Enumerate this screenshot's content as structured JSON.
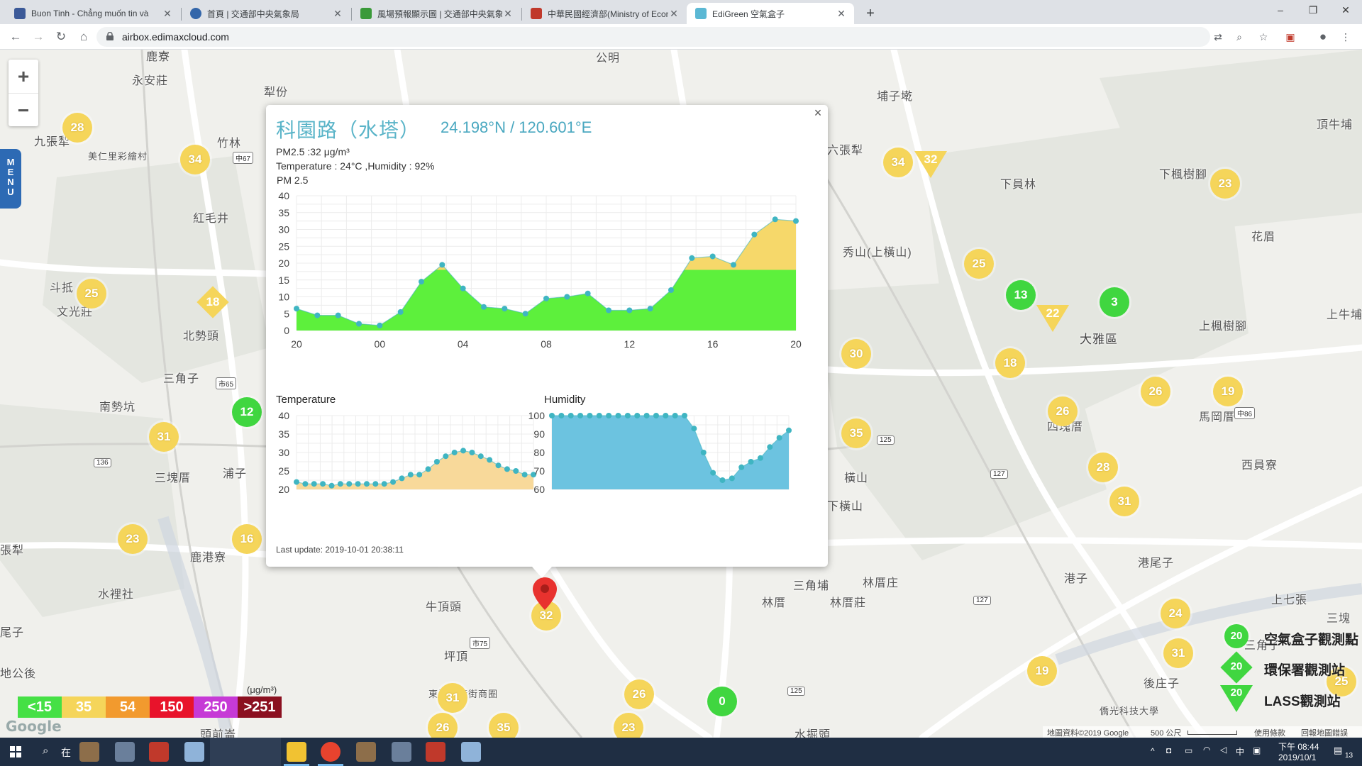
{
  "browser": {
    "tabs": [
      {
        "title": "Buon Tinh - Chẳng muốn tin và",
        "color": "#3b5998"
      },
      {
        "title": "首頁 | 交通部中央氣象局",
        "color": "#3366aa"
      },
      {
        "title": "風場預報顯示圖 | 交通部中央氣象",
        "color": "#3a9a3a"
      },
      {
        "title": "中華民國經濟部(Ministry of Econ",
        "color": "#c0392b"
      },
      {
        "title": "EdiGreen 空氣盒子",
        "color": "#5bb8d4"
      }
    ],
    "new_tab": "+",
    "url": "airbox.edimaxcloud.com",
    "window_controls": {
      "minimize": "–",
      "restore": "❐",
      "close": "✕"
    }
  },
  "map": {
    "zoom_in": "+",
    "zoom_out": "−",
    "menu_label": "MENU",
    "places": [
      {
        "text": "鹿寮"
      },
      {
        "text": "公明"
      },
      {
        "text": "永安莊"
      },
      {
        "text": "犁份"
      },
      {
        "text": "埔子墘"
      },
      {
        "text": "九張犁"
      },
      {
        "text": "竹林"
      },
      {
        "text": "美仁里彩繪村"
      },
      {
        "text": "六張犁"
      },
      {
        "text": "頂牛埔"
      },
      {
        "text": "下員林"
      },
      {
        "text": "下楓樹腳"
      },
      {
        "text": "紅毛井"
      },
      {
        "text": "花眉"
      },
      {
        "text": "秀山(上橫山)"
      },
      {
        "text": "斗抵"
      },
      {
        "text": "文光莊"
      },
      {
        "text": "北勢頭"
      },
      {
        "text": "上楓樹腳"
      },
      {
        "text": "大雅區"
      },
      {
        "text": "上牛埔"
      },
      {
        "text": "三角子"
      },
      {
        "text": "南勢坑"
      },
      {
        "text": "四塊厝"
      },
      {
        "text": "馬岡厝"
      },
      {
        "text": "三塊厝"
      },
      {
        "text": "浦子"
      },
      {
        "text": "橫山"
      },
      {
        "text": "下橫山"
      },
      {
        "text": "西員寮"
      },
      {
        "text": "鹿港寮"
      },
      {
        "text": "港子"
      },
      {
        "text": "港尾子"
      },
      {
        "text": "林厝庄"
      },
      {
        "text": "林厝"
      },
      {
        "text": "林厝莊"
      },
      {
        "text": "三角埔"
      },
      {
        "text": "牛頂頭"
      },
      {
        "text": "水裡社"
      },
      {
        "text": "上七張"
      },
      {
        "text": "坪頂"
      },
      {
        "text": "東海藝術街商圈"
      },
      {
        "text": "頭前崙"
      },
      {
        "text": "後庄子"
      },
      {
        "text": "水掘頭"
      },
      {
        "text": "地公後"
      },
      {
        "text": "張犁"
      },
      {
        "text": "僑光科技大學"
      },
      {
        "text": "尾子"
      },
      {
        "text": "三塊"
      },
      {
        "text": "三角子"
      }
    ],
    "roads": [
      {
        "text": "中67"
      },
      {
        "text": "市65"
      },
      {
        "text": "136"
      },
      {
        "text": "125"
      },
      {
        "text": "127"
      },
      {
        "text": "市75"
      },
      {
        "text": "125"
      },
      {
        "text": "127"
      },
      {
        "text": "中86"
      }
    ],
    "markers": [
      {
        "value": "28",
        "kind": "circle",
        "color": "yellow"
      },
      {
        "value": "34",
        "kind": "circle",
        "color": "yellow"
      },
      {
        "value": "25",
        "kind": "circle",
        "color": "yellow"
      },
      {
        "value": "18",
        "kind": "diamond",
        "color": "yellow"
      },
      {
        "value": "12",
        "kind": "circle",
        "color": "green"
      },
      {
        "value": "31",
        "kind": "circle",
        "color": "yellow"
      },
      {
        "value": "23",
        "kind": "circle",
        "color": "yellow"
      },
      {
        "value": "16",
        "kind": "circle",
        "color": "yellow"
      },
      {
        "value": "34",
        "kind": "circle",
        "color": "yellow"
      },
      {
        "value": "32",
        "kind": "triangle",
        "color": "yellow"
      },
      {
        "value": "23",
        "kind": "circle",
        "color": "yellow"
      },
      {
        "value": "25",
        "kind": "circle",
        "color": "yellow"
      },
      {
        "value": "13",
        "kind": "circle",
        "color": "green"
      },
      {
        "value": "22",
        "kind": "triangle",
        "color": "yellow"
      },
      {
        "value": "3",
        "kind": "circle",
        "color": "green"
      },
      {
        "value": "30",
        "kind": "circle",
        "color": "yellow"
      },
      {
        "value": "18",
        "kind": "circle",
        "color": "yellow"
      },
      {
        "value": "26",
        "kind": "circle",
        "color": "yellow"
      },
      {
        "value": "19",
        "kind": "circle",
        "color": "yellow"
      },
      {
        "value": "26",
        "kind": "circle",
        "color": "yellow"
      },
      {
        "value": "35",
        "kind": "circle",
        "color": "yellow"
      },
      {
        "value": "28",
        "kind": "circle",
        "color": "yellow"
      },
      {
        "value": "31",
        "kind": "circle",
        "color": "yellow"
      },
      {
        "value": "24",
        "kind": "circle",
        "color": "yellow"
      },
      {
        "value": "31",
        "kind": "circle",
        "color": "yellow"
      },
      {
        "value": "19",
        "kind": "circle",
        "color": "yellow"
      },
      {
        "value": "25",
        "kind": "circle",
        "color": "yellow"
      },
      {
        "value": "32",
        "kind": "circle",
        "color": "yellow"
      },
      {
        "value": "31",
        "kind": "circle",
        "color": "yellow"
      },
      {
        "value": "26",
        "kind": "circle",
        "color": "yellow"
      },
      {
        "value": "35",
        "kind": "circle",
        "color": "yellow"
      },
      {
        "value": "26",
        "kind": "circle",
        "color": "yellow"
      },
      {
        "value": "23",
        "kind": "circle",
        "color": "yellow"
      },
      {
        "value": "0",
        "kind": "circle",
        "color": "green"
      }
    ],
    "pm_legend": [
      {
        "label": "<15",
        "color": "#45e045"
      },
      {
        "label": "35",
        "color": "#f5d55a"
      },
      {
        "label": "54",
        "color": "#f29a2e"
      },
      {
        "label": "150",
        "color": "#e8132b"
      },
      {
        "label": "250",
        "color": "#c63ad6"
      },
      {
        "label": ">251",
        "color": "#8b1020"
      }
    ],
    "pm_unit": "(μg/m³)",
    "google_logo": "Google",
    "attribution": {
      "data": "地圖資料©2019 Google",
      "scale": "500 公尺",
      "terms": "使用條款",
      "report": "回報地圖錯誤"
    },
    "station_legend": [
      {
        "value": "20",
        "label": "空氣盒子觀測點"
      },
      {
        "value": "20",
        "label": "環保署觀測站"
      },
      {
        "value": "20",
        "label": "LASS觀測站"
      }
    ]
  },
  "popup": {
    "close": "×",
    "title": "科園路（水塔）",
    "coords": "24.198°N / 120.601°E",
    "pm_line": "PM2.5 :32 μg/m³",
    "env_line": "Temperature : 24°C ,Humidity : 92%",
    "chart_heading": "PM 2.5",
    "temp_heading": "Temperature",
    "hum_heading": "Humidity",
    "last_update": "Last update: 2019-10-01 20:38:11"
  },
  "chart_data": [
    {
      "type": "area",
      "title": "PM 2.5",
      "x_ticks": [
        "20",
        "00",
        "04",
        "08",
        "12",
        "16",
        "20"
      ],
      "ylim": [
        0,
        40
      ],
      "y_ticks": [
        0,
        5,
        10,
        15,
        20,
        25,
        30,
        35,
        40
      ],
      "values": [
        6.5,
        4.5,
        4.5,
        2,
        1.5,
        5.5,
        14.5,
        19.5,
        12.5,
        7,
        6.5,
        5,
        9.5,
        10,
        11,
        6,
        6,
        6.5,
        12,
        21.5,
        22,
        19.5,
        28.5,
        33,
        32.5
      ],
      "threshold": 18,
      "colors": {
        "below": "#5df03c",
        "above": "#f6d86a",
        "point": "#3fb5c2"
      }
    },
    {
      "type": "area",
      "title": "Temperature",
      "ylim": [
        20,
        40
      ],
      "y_ticks": [
        20,
        25,
        30,
        35,
        40
      ],
      "values": [
        22,
        21.5,
        21.5,
        21.5,
        21,
        21.5,
        21.5,
        21.5,
        21.5,
        21.5,
        21.5,
        22,
        23,
        24,
        24,
        25.5,
        27.5,
        29,
        30,
        30.5,
        30,
        29,
        28,
        26.5,
        25.5,
        25,
        24,
        24
      ],
      "colors": {
        "fill": "#f8d99a",
        "point": "#3fb5c2"
      }
    },
    {
      "type": "area",
      "title": "Humidity",
      "ylim": [
        60,
        100
      ],
      "y_ticks": [
        60,
        70,
        80,
        90,
        100
      ],
      "values": [
        100,
        100,
        100,
        100,
        100,
        100,
        100,
        100,
        100,
        100,
        100,
        100,
        100,
        100,
        100,
        93,
        80,
        69,
        65,
        66,
        72,
        75,
        77,
        83,
        88,
        92
      ],
      "colors": {
        "fill": "#6cc3e0",
        "point": "#3fb5c2"
      }
    }
  ],
  "taskbar": {
    "search_hint": "在",
    "ime": "中",
    "time": "下午 08:44",
    "date": "2019/10/1",
    "notify_count": "13"
  }
}
